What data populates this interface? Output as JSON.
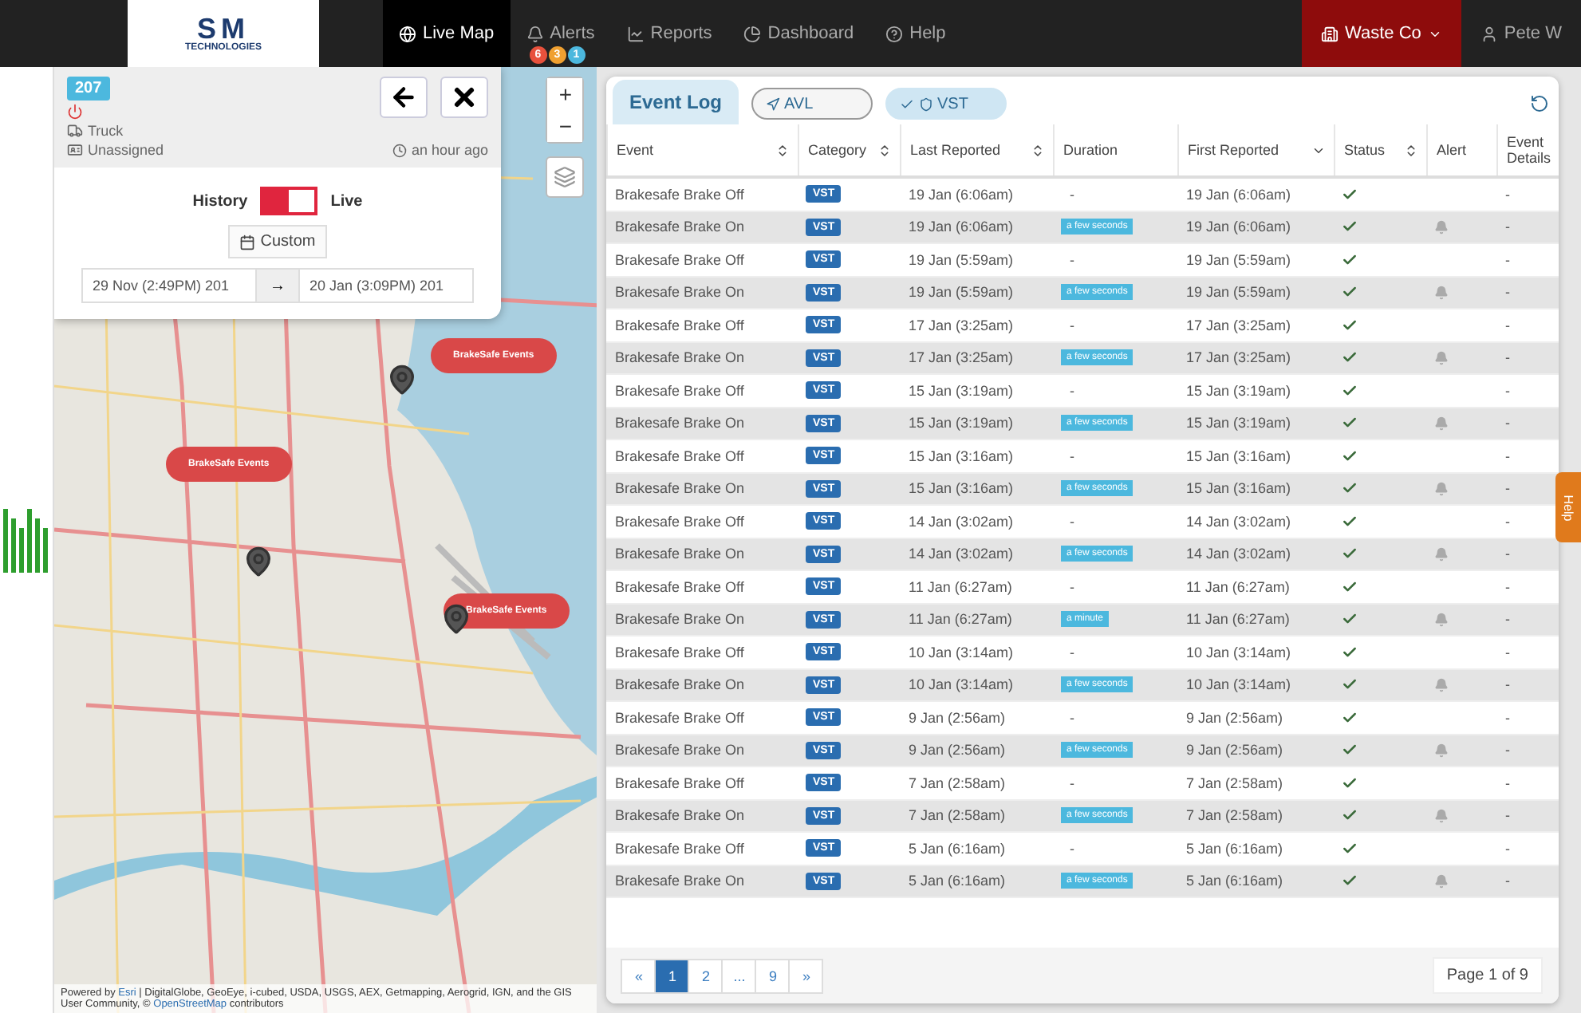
{
  "navbar": {
    "logo": {
      "mark": "SM",
      "subtitle": "TECHNOLOGIES"
    },
    "items": [
      {
        "label": "Live Map",
        "selected": true
      },
      {
        "label": "Alerts",
        "selected": false,
        "badges": [
          {
            "text": "6",
            "color": "#e8513c"
          },
          {
            "text": "3",
            "color": "#f0a030"
          },
          {
            "text": "1",
            "color": "#4cb8de"
          }
        ]
      },
      {
        "label": "Reports",
        "selected": false
      },
      {
        "label": "Dashboard",
        "selected": false
      },
      {
        "label": "Help",
        "selected": false
      }
    ],
    "company": "Waste Co",
    "user": "Pete W"
  },
  "vehicle_panel": {
    "id": "207",
    "type": "Truck",
    "driver": "Unassigned",
    "last_seen": "an hour ago",
    "toggle": {
      "left_label": "History",
      "right_label": "Live",
      "on": true
    },
    "range_button": "Custom",
    "date_from": "29 Nov (2:49PM) 201",
    "arrow": "→",
    "date_to": "20 Jan (3:09PM) 201"
  },
  "map": {
    "zoom_in": "+",
    "zoom_out": "−",
    "callouts": [
      {
        "label": "BrakeSafe Events"
      },
      {
        "label": "BrakeSafe Events"
      },
      {
        "label": "BrakeSafe Events"
      }
    ],
    "attribution": {
      "before": "Powered by",
      "link_1": "Esri",
      "middle": "| DigitalGlobe, GeoEye, i-cubed, USDA, USGS, AEX, Getmapping, Aerogrid, IGN, and the GIS User Community, ©",
      "link_2": "OpenStreetMap",
      "after": "contributors"
    }
  },
  "event_log": {
    "title": "Event Log",
    "filters": [
      {
        "label": "AVL",
        "selected": false
      },
      {
        "label": "VST",
        "selected": true
      }
    ],
    "columns": [
      "Event",
      "Category",
      "Last Reported",
      "Duration",
      "First Reported",
      "Status",
      "Alert",
      "Event Details"
    ],
    "rows": [
      {
        "kind": "plain",
        "event": "Brakesafe Brake Off",
        "category": "VST",
        "last": "19 Jan (6:06am)",
        "duration": "-",
        "first": "19 Jan (6:06am)",
        "status": true,
        "alert": false,
        "details": "-"
      },
      {
        "kind": "badge",
        "event": "Brakesafe Brake On",
        "category": "VST",
        "last": "19 Jan (6:06am)",
        "duration": "a few seconds",
        "first": "19 Jan (6:06am)",
        "status": true,
        "alert": true,
        "details": "-"
      },
      {
        "kind": "plain",
        "event": "Brakesafe Brake Off",
        "category": "VST",
        "last": "19 Jan (5:59am)",
        "duration": "-",
        "first": "19 Jan (5:59am)",
        "status": true,
        "alert": false,
        "details": "-"
      },
      {
        "kind": "badge",
        "event": "Brakesafe Brake On",
        "category": "VST",
        "last": "19 Jan (5:59am)",
        "duration": "a few seconds",
        "first": "19 Jan (5:59am)",
        "status": true,
        "alert": true,
        "details": "-"
      },
      {
        "kind": "plain",
        "event": "Brakesafe Brake Off",
        "category": "VST",
        "last": "17 Jan (3:25am)",
        "duration": "-",
        "first": "17 Jan (3:25am)",
        "status": true,
        "alert": false,
        "details": "-"
      },
      {
        "kind": "badge",
        "event": "Brakesafe Brake On",
        "category": "VST",
        "last": "17 Jan (3:25am)",
        "duration": "a few seconds",
        "first": "17 Jan (3:25am)",
        "status": true,
        "alert": true,
        "details": "-"
      },
      {
        "kind": "plain",
        "event": "Brakesafe Brake Off",
        "category": "VST",
        "last": "15 Jan (3:19am)",
        "duration": "-",
        "first": "15 Jan (3:19am)",
        "status": true,
        "alert": false,
        "details": "-"
      },
      {
        "kind": "badge",
        "event": "Brakesafe Brake On",
        "category": "VST",
        "last": "15 Jan (3:19am)",
        "duration": "a few seconds",
        "first": "15 Jan (3:19am)",
        "status": true,
        "alert": true,
        "details": "-"
      },
      {
        "kind": "plain",
        "event": "Brakesafe Brake Off",
        "category": "VST",
        "last": "15 Jan (3:16am)",
        "duration": "-",
        "first": "15 Jan (3:16am)",
        "status": true,
        "alert": false,
        "details": "-"
      },
      {
        "kind": "badge",
        "event": "Brakesafe Brake On",
        "category": "VST",
        "last": "15 Jan (3:16am)",
        "duration": "a few seconds",
        "first": "15 Jan (3:16am)",
        "status": true,
        "alert": true,
        "details": "-"
      },
      {
        "kind": "plain",
        "event": "Brakesafe Brake Off",
        "category": "VST",
        "last": "14 Jan (3:02am)",
        "duration": "-",
        "first": "14 Jan (3:02am)",
        "status": true,
        "alert": false,
        "details": "-"
      },
      {
        "kind": "badge",
        "event": "Brakesafe Brake On",
        "category": "VST",
        "last": "14 Jan (3:02am)",
        "duration": "a few seconds",
        "first": "14 Jan (3:02am)",
        "status": true,
        "alert": true,
        "details": "-"
      },
      {
        "kind": "plain",
        "event": "Brakesafe Brake Off",
        "category": "VST",
        "last": "11 Jan (6:27am)",
        "duration": "-",
        "first": "11 Jan (6:27am)",
        "status": true,
        "alert": false,
        "details": "-"
      },
      {
        "kind": "badge",
        "event": "Brakesafe Brake On",
        "category": "VST",
        "last": "11 Jan (6:27am)",
        "duration": "a minute",
        "first": "11 Jan (6:27am)",
        "status": true,
        "alert": true,
        "details": "-"
      },
      {
        "kind": "plain",
        "event": "Brakesafe Brake Off",
        "category": "VST",
        "last": "10 Jan (3:14am)",
        "duration": "-",
        "first": "10 Jan (3:14am)",
        "status": true,
        "alert": false,
        "details": "-"
      },
      {
        "kind": "badge",
        "event": "Brakesafe Brake On",
        "category": "VST",
        "last": "10 Jan (3:14am)",
        "duration": "a few seconds",
        "first": "10 Jan (3:14am)",
        "status": true,
        "alert": true,
        "details": "-"
      },
      {
        "kind": "plain",
        "event": "Brakesafe Brake Off",
        "category": "VST",
        "last": "9 Jan (2:56am)",
        "duration": "-",
        "first": "9 Jan (2:56am)",
        "status": true,
        "alert": false,
        "details": "-"
      },
      {
        "kind": "badge",
        "event": "Brakesafe Brake On",
        "category": "VST",
        "last": "9 Jan (2:56am)",
        "duration": "a few seconds",
        "first": "9 Jan (2:56am)",
        "status": true,
        "alert": true,
        "details": "-"
      },
      {
        "kind": "plain",
        "event": "Brakesafe Brake Off",
        "category": "VST",
        "last": "7 Jan (2:58am)",
        "duration": "-",
        "first": "7 Jan (2:58am)",
        "status": true,
        "alert": false,
        "details": "-"
      },
      {
        "kind": "badge",
        "event": "Brakesafe Brake On",
        "category": "VST",
        "last": "7 Jan (2:58am)",
        "duration": "a few seconds",
        "first": "7 Jan (2:58am)",
        "status": true,
        "alert": true,
        "details": "-"
      },
      {
        "kind": "plain",
        "event": "Brakesafe Brake Off",
        "category": "VST",
        "last": "5 Jan (6:16am)",
        "duration": "-",
        "first": "5 Jan (6:16am)",
        "status": true,
        "alert": false,
        "details": "-"
      },
      {
        "kind": "badge",
        "event": "Brakesafe Brake On",
        "category": "VST",
        "last": "5 Jan (6:16am)",
        "duration": "a few seconds",
        "first": "5 Jan (6:16am)",
        "status": true,
        "alert": true,
        "details": "-"
      }
    ],
    "pagination": {
      "prev": "«",
      "pages": [
        {
          "label": "1",
          "selected": true
        },
        {
          "label": "2",
          "selected": false
        },
        {
          "label": "...",
          "selected": false
        },
        {
          "label": "9",
          "selected": false
        }
      ],
      "next": "»",
      "summary": "Page 1 of 9"
    }
  },
  "help_tab": "Help"
}
